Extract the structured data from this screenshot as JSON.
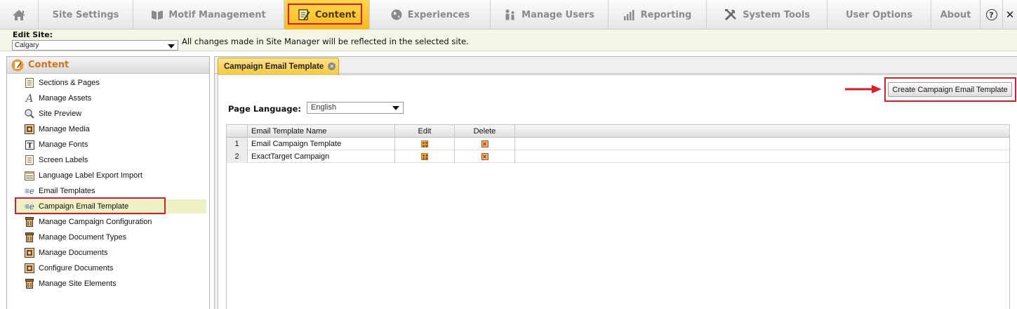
{
  "nav": {
    "items": [
      {
        "label": "",
        "icon": "home-icon"
      },
      {
        "label": "Site Settings",
        "icon": ""
      },
      {
        "label": "Motif Management",
        "icon": "motif-icon"
      },
      {
        "label": "Content",
        "icon": "content-icon",
        "active": true
      },
      {
        "label": "Experiences",
        "icon": "globe-icon"
      },
      {
        "label": "Manage Users",
        "icon": "users-icon"
      },
      {
        "label": "Reporting",
        "icon": "bar-chart-icon"
      },
      {
        "label": "System Tools",
        "icon": "tools-icon"
      },
      {
        "label": "User Options",
        "icon": ""
      },
      {
        "label": "About",
        "icon": ""
      },
      {
        "label": "?",
        "icon": "help-icon"
      }
    ],
    "close_label": "✕"
  },
  "edit_site": {
    "label": "Edit Site:",
    "selected": "Calgary",
    "message": "All changes made in Site Manager will be reflected in the selected site."
  },
  "sidebar": {
    "title": "Content",
    "items": [
      {
        "label": "Sections & Pages",
        "icon": "page-icon"
      },
      {
        "label": "Manage Assets",
        "icon": "font-a-icon"
      },
      {
        "label": "Site Preview",
        "icon": "magnifier-icon"
      },
      {
        "label": "Manage Media",
        "icon": "media-icon"
      },
      {
        "label": "Manage Fonts",
        "icon": "font-t-icon"
      },
      {
        "label": "Screen Labels",
        "icon": "page-icon"
      },
      {
        "label": "Language Label Export Import",
        "icon": "table-icon"
      },
      {
        "label": "Email Templates",
        "icon": "email-icon"
      },
      {
        "label": "Campaign Email Template",
        "icon": "email-icon",
        "selected": true
      },
      {
        "label": "Manage Campaign Configuration",
        "icon": "bin-icon"
      },
      {
        "label": "Manage Document Types",
        "icon": "bin-icon"
      },
      {
        "label": "Manage Documents",
        "icon": "media-icon"
      },
      {
        "label": "Configure Documents",
        "icon": "media-icon"
      },
      {
        "label": "Manage Site Elements",
        "icon": "bin-icon"
      }
    ]
  },
  "main": {
    "tab": {
      "label": "Campaign Email Template"
    },
    "create_button": "Create Campaign Email Template",
    "page_language": {
      "label": "Page Language:",
      "value": "English"
    },
    "grid": {
      "columns": [
        "Email Template Name",
        "Edit",
        "Delete"
      ],
      "rows": [
        {
          "num": "1",
          "name": "Email Campaign Template"
        },
        {
          "num": "2",
          "name": "ExactTarget Campaign"
        }
      ]
    }
  },
  "colors": {
    "accent": "#f7b923",
    "highlight_outline": "#d61f26",
    "sidebar_title": "#d0731a",
    "selected_row": "#eef1c4"
  }
}
